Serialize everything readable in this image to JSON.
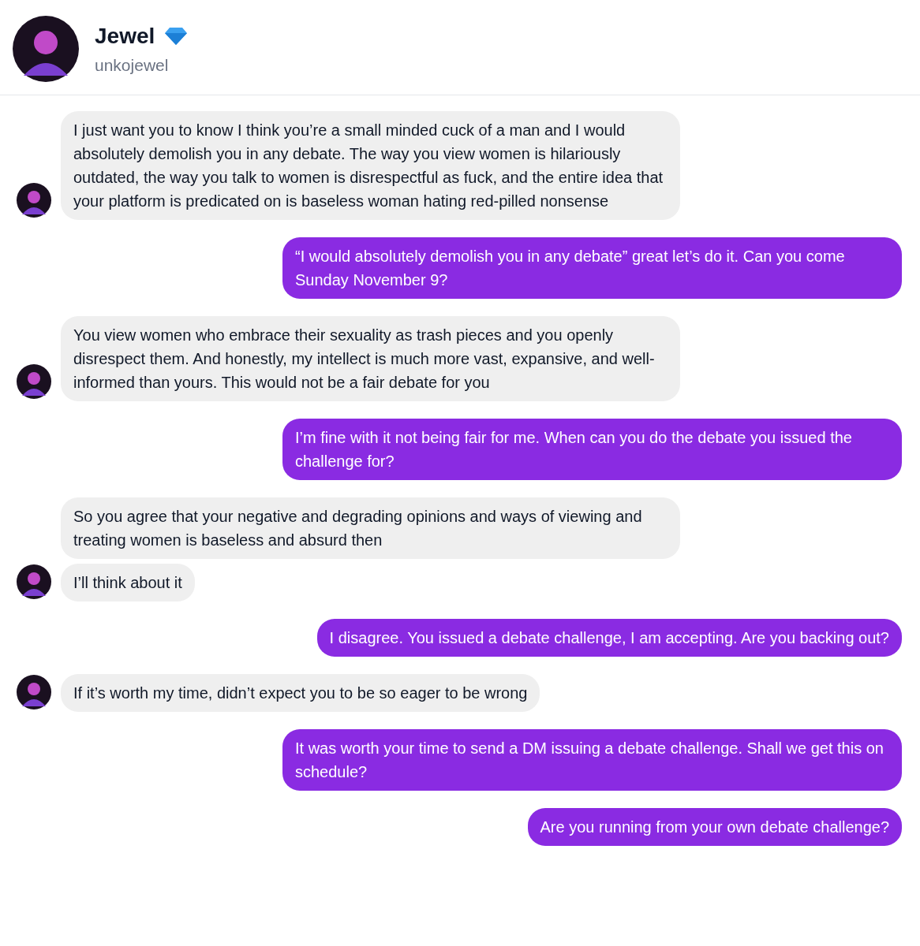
{
  "profile": {
    "name": "Jewel",
    "username": "unkojewel"
  },
  "messages": [
    {
      "kind": "incoming",
      "texts": [
        "I just want you to know I think you’re a small minded cuck of a man and I would absolutely demolish you in any debate. The way you view women is hilariously outdated, the way you talk to women is disrespectful as fuck, and the entire idea that your platform is predicated on is baseless woman hating red-pilled nonsense"
      ]
    },
    {
      "kind": "outgoing",
      "texts": [
        "“I would absolutely demolish you in any debate” great let’s do it. Can you come Sunday November 9?"
      ]
    },
    {
      "kind": "incoming",
      "texts": [
        "You view women who embrace their sexuality as trash pieces and you openly disrespect them. And honestly, my intellect is much more vast, expansive, and well-informed than yours. This would not be a fair debate for you"
      ]
    },
    {
      "kind": "outgoing",
      "texts": [
        "I’m fine with it not being fair for me. When can you do the debate you issued the challenge for?"
      ]
    },
    {
      "kind": "incoming",
      "texts": [
        "So you agree that your negative and degrading opinions and ways of viewing and treating women is baseless and absurd then",
        "I’ll think about it"
      ]
    },
    {
      "kind": "outgoing",
      "texts": [
        "I disagree. You issued a debate challenge, I am accepting. Are you backing out?"
      ]
    },
    {
      "kind": "incoming",
      "texts": [
        "If it’s worth my time, didn’t expect you to be so eager to be wrong"
      ]
    },
    {
      "kind": "outgoing",
      "texts": [
        "It was worth your time to send a DM issuing a debate challenge. Shall we get this on schedule?"
      ]
    },
    {
      "kind": "outgoing",
      "texts": [
        "Are you running from your own debate challenge?"
      ]
    }
  ]
}
